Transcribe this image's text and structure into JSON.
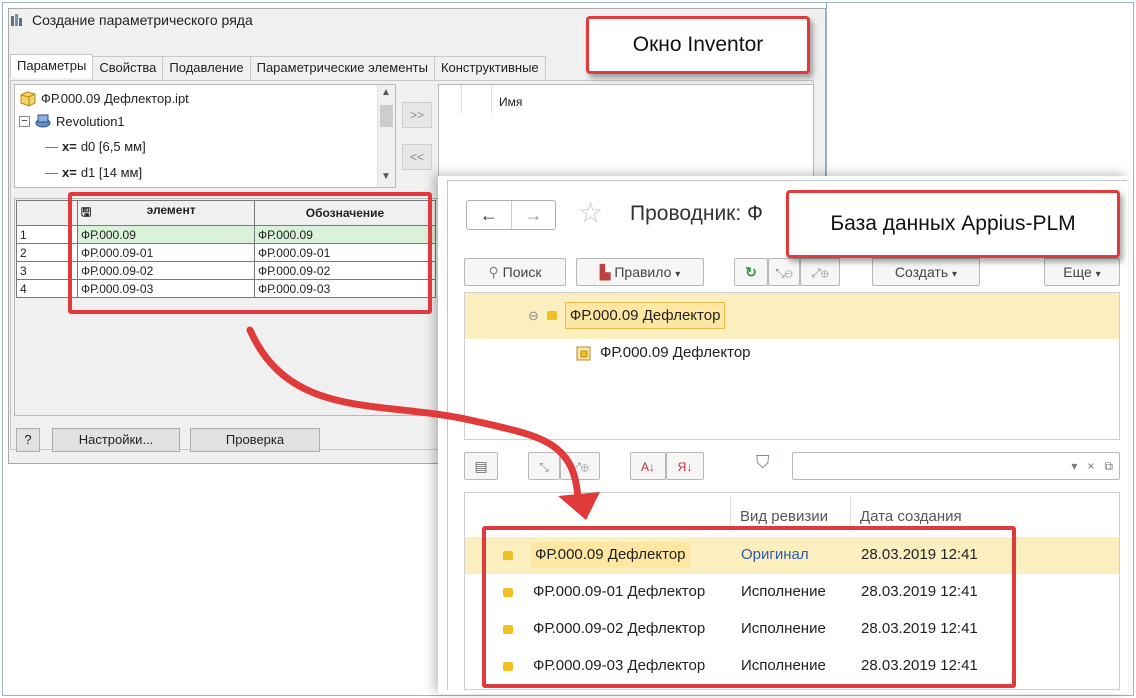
{
  "inventor": {
    "title": "Создание параметрического ряда",
    "tabs": [
      "Параметры",
      "Свойства",
      "Подавление",
      "Параметрические элементы",
      "Конструктивные"
    ],
    "tree": {
      "file": "ФР.000.09 Дефлектор.ipt",
      "feature": "Revolution1",
      "params": [
        "d0 [6,5 мм]",
        "d1 [14 мм]"
      ],
      "param_prefix": "x="
    },
    "move_right": ">>",
    "move_left": "<<",
    "name_header": "Имя",
    "grid": {
      "headers": [
        "элемент",
        "Обозначение"
      ],
      "rows": [
        {
          "n": "1",
          "element": "ФР.000.09",
          "designation": "ФР.000.09"
        },
        {
          "n": "2",
          "element": "ФР.000.09-01",
          "designation": "ФР.000.09-01"
        },
        {
          "n": "3",
          "element": "ФР.000.09-02",
          "designation": "ФР.000.09-02"
        },
        {
          "n": "4",
          "element": "ФР.000.09-03",
          "designation": "ФР.000.09-03"
        }
      ]
    },
    "help_label": "?",
    "settings_label": "Настройки...",
    "check_label": "Проверка"
  },
  "appius": {
    "title": "Проводник: Ф",
    "toolbar": {
      "search": "Поиск",
      "rule": "Правило",
      "create": "Создать",
      "more": "Еще"
    },
    "tree": {
      "root": "ФР.000.09 Дефлектор",
      "child": "ФР.000.09 Дефлектор"
    },
    "filter_value": "",
    "columns": [
      "Вид ревизии",
      "Дата создания"
    ],
    "rows": [
      {
        "name": "ФР.000.09 Дефлектор",
        "kind": "Оригинал",
        "date": "28.03.2019 12:41"
      },
      {
        "name": "ФР.000.09-01 Дефлектор",
        "kind": "Исполнение",
        "date": "28.03.2019 12:41"
      },
      {
        "name": "ФР.000.09-02 Дефлектор",
        "kind": "Исполнение",
        "date": "28.03.2019 12:41"
      },
      {
        "name": "ФР.000.09-03 Дефлектор",
        "kind": "Исполнение",
        "date": "28.03.2019 12:41"
      }
    ]
  },
  "callouts": {
    "inventor": "Окно Inventor",
    "appius": "База данных Appius-PLM"
  },
  "colors": {
    "accent_red": "#e03a3a",
    "selection": "#fbefc0",
    "link_blue": "#2a5da8"
  }
}
